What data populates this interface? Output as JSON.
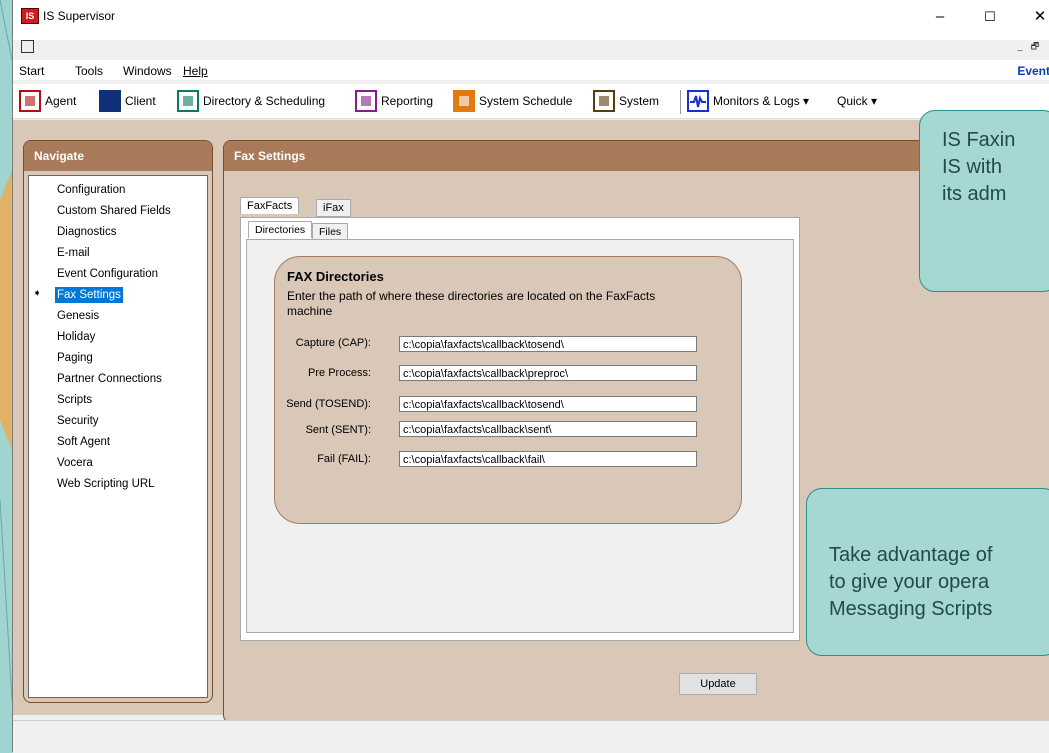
{
  "window": {
    "title": "IS Supervisor",
    "app_icon_text": "IS",
    "minimize": "–",
    "maximize": "☐",
    "close": "✕"
  },
  "mdi_controls": {
    "minimize": "_",
    "restore": "🗗"
  },
  "menubar": {
    "items": [
      "Start",
      "Tools",
      "Windows",
      "Help"
    ],
    "right_text": "Event"
  },
  "toolbar": {
    "agent": "Agent",
    "client": "Client",
    "directory": "Directory & Scheduling",
    "reporting": "Reporting",
    "system_schedule": "System Schedule",
    "system": "System",
    "monitors": "Monitors & Logs ▾",
    "quick": "Quick ▾"
  },
  "navigate": {
    "header": "Navigate",
    "items": [
      "Configuration",
      "Custom Shared Fields",
      "Diagnostics",
      "E-mail",
      "Event Configuration",
      "Fax Settings",
      "Genesis",
      "Holiday",
      "Paging",
      "Partner Connections",
      "Scripts",
      "Security",
      "Soft Agent",
      "Vocera",
      "Web Scripting URL"
    ],
    "selected": "Fax Settings",
    "selected_marker": "➧"
  },
  "fax_settings": {
    "header": "Fax Settings",
    "tabs": [
      "FaxFacts",
      "iFax"
    ],
    "subtabs": [
      "Directories",
      "Files"
    ],
    "group": {
      "title": "FAX Directories",
      "description": "Enter the path of where these directories are located on the FaxFacts machine",
      "fields": [
        {
          "label": "Capture (CAP):",
          "value": "c:\\copia\\faxfacts\\callback\\tosend\\"
        },
        {
          "label": "Pre Process:",
          "value": "c:\\copia\\faxfacts\\callback\\preproc\\"
        },
        {
          "label": "Send (TOSEND):",
          "value": "c:\\copia\\faxfacts\\callback\\tosend\\"
        },
        {
          "label": "Sent (SENT):",
          "value": "c:\\copia\\faxfacts\\callback\\sent\\"
        },
        {
          "label": "Fail (FAIL):",
          "value": "c:\\copia\\faxfacts\\callback\\fail\\"
        }
      ]
    },
    "update_label": "Update"
  },
  "callouts": {
    "top": [
      "IS Faxin",
      "IS with",
      "its adm"
    ],
    "bottom": [
      "Take advantage of",
      "to give your opera",
      "Messaging Scripts"
    ]
  },
  "colors": {
    "panel_header": "#a87a5a",
    "panel_bg": "#d9c7b7",
    "callout_bg": "#a6d8d3",
    "selection": "#0078d7"
  }
}
